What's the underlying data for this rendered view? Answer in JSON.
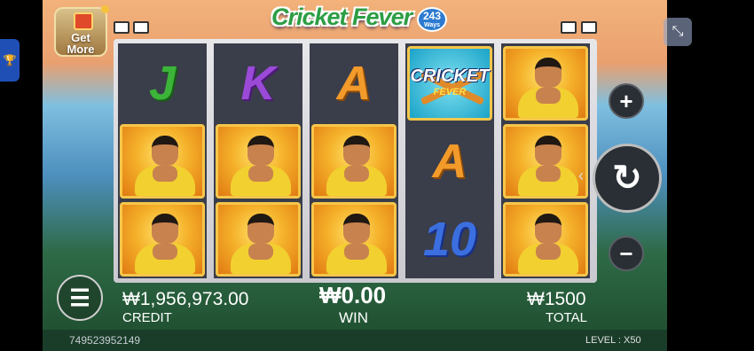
{
  "window": {
    "title": "Cricket Fever"
  },
  "header": {
    "get_more_label": "Get More",
    "game_title": "Cricket Fever",
    "ways_number": "243",
    "ways_label": "Ways",
    "side_tab_icon": "trophy-icon",
    "minimize_icon": "collapse-icon"
  },
  "reels": [
    [
      "J",
      "face",
      "face"
    ],
    [
      "K",
      "face",
      "face"
    ],
    [
      "A",
      "face",
      "face"
    ],
    [
      "logo",
      "A",
      "10"
    ],
    [
      "face",
      "face",
      "face"
    ]
  ],
  "symbols": {
    "logo_line1": "CRICKET",
    "logo_line2": "FEVER"
  },
  "controls": {
    "plus_icon": "+",
    "minus_icon": "−",
    "spin_icon": "↻",
    "menu_icon": "☰"
  },
  "hud": {
    "credit_value": "₩1,956,973.00",
    "credit_label": "CREDIT",
    "win_value": "₩0.00",
    "win_label": "WIN",
    "total_value": "₩1500",
    "total_label": "TOTAL"
  },
  "footer": {
    "session_id": "749523952149",
    "level_label": "LEVEL :",
    "level_value": "X50"
  }
}
